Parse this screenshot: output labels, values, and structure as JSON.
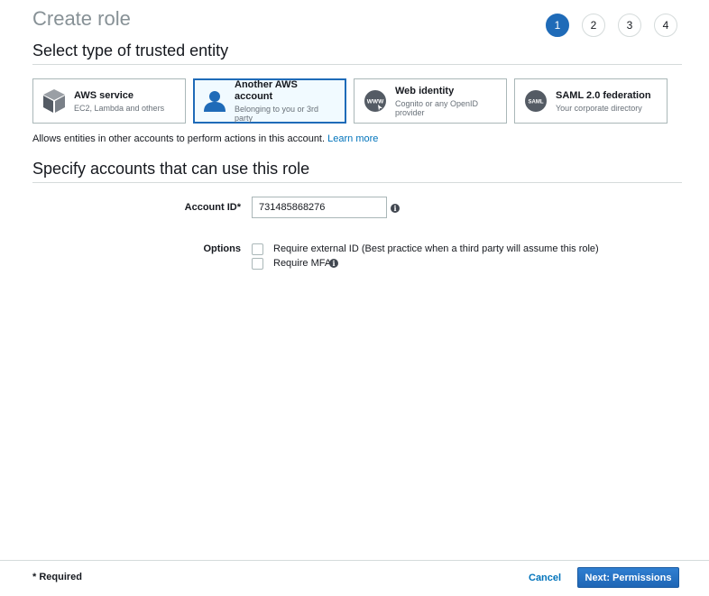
{
  "page": {
    "title": "Create role"
  },
  "steps": [
    "1",
    "2",
    "3",
    "4"
  ],
  "section1": {
    "heading": "Select type of trusted entity"
  },
  "entities": [
    {
      "title": "AWS service",
      "desc": "EC2, Lambda and others",
      "icon": "cube-icon"
    },
    {
      "title": "Another AWS account",
      "desc": "Belonging to you or 3rd party",
      "icon": "user-icon"
    },
    {
      "title": "Web identity",
      "desc": "Cognito or any OpenID provider",
      "icon": "www-icon",
      "icon_text": "WWW"
    },
    {
      "title": "SAML 2.0 federation",
      "desc": "Your corporate directory",
      "icon": "saml-icon",
      "icon_text": "SAML"
    }
  ],
  "info": {
    "text": "Allows entities in other accounts to perform actions in this account.",
    "link": "Learn more"
  },
  "section2": {
    "heading": "Specify accounts that can use this role"
  },
  "form": {
    "account_label": "Account ID*",
    "account_value": "731485868276",
    "options_label": "Options",
    "option1": "Require external ID (Best practice when a third party will assume this role)",
    "option2": "Require MFA",
    "info_glyph": "i"
  },
  "footer": {
    "required": "* Required",
    "cancel": "Cancel",
    "next": "Next: Permissions"
  },
  "colors": {
    "accent": "#1f6bb8",
    "link": "#0073bb",
    "border": "#aab7b8"
  }
}
